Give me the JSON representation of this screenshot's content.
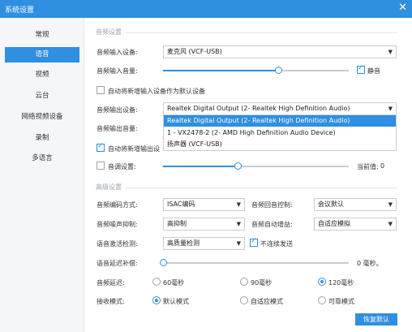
{
  "window": {
    "title": "系统设置"
  },
  "sidebar": {
    "items": [
      {
        "label": "常规"
      },
      {
        "label": "语音"
      },
      {
        "label": "视频"
      },
      {
        "label": "云台"
      },
      {
        "label": "网络视频设备"
      },
      {
        "label": "录制"
      },
      {
        "label": "多语言"
      }
    ],
    "active_index": 1
  },
  "audio_settings": {
    "section_title": "音频设置",
    "input_device": {
      "label": "音频输入设备:",
      "value": "麦克风 (VCF-USB)"
    },
    "input_volume": {
      "label": "音频输入音量:",
      "level_percent": 62,
      "mute_label": "静音",
      "mute_checked": true
    },
    "auto_default_input": {
      "label": "自动将新增输入设备作为默认设备",
      "checked": false
    },
    "output_device": {
      "label": "音频输出设备:",
      "value": "Realtek Digital Output (2- Realtek High Definition Audio)",
      "options": [
        "Realtek Digital Output (2- Realtek High Definition Audio)",
        "1 - VX2478-2 (2- AMD High Definition Audio Device)",
        "扬声器 (VCF-USB)"
      ],
      "highlighted_index": 0
    },
    "output_volume": {
      "label": "音频输出音量:"
    },
    "auto_default_output": {
      "label": "自动将新增输出设",
      "checked": true
    },
    "tone": {
      "label": "音调设置:",
      "checked": false,
      "level_percent": 40,
      "current_label": "当前值:",
      "current_value": "0"
    }
  },
  "advanced_settings": {
    "section_title": "高级设置",
    "codec": {
      "label": "音频编码方式:",
      "value": "ISAC编码"
    },
    "echo": {
      "label": "音频回音控制:",
      "value": "会议默认"
    },
    "noise": {
      "label": "音频噪声抑制:",
      "value": "高抑制"
    },
    "agc": {
      "label": "音频自动增益:",
      "value": "自适应模拟"
    },
    "vad": {
      "label": "语音激活检测:",
      "value": "高质量检测"
    },
    "no_continuous": {
      "label": "不连续发送",
      "checked": true
    },
    "delay_comp": {
      "label": "语音延迟补偿:",
      "level_percent": 0,
      "value_text": "0 毫秒。"
    },
    "audio_delay": {
      "label": "音频延迟:",
      "options": [
        "60毫秒",
        "90毫秒",
        "120毫秒"
      ],
      "selected_index": 2
    },
    "receive_mode": {
      "label": "接收模式:",
      "options": [
        "默认模式",
        "自适应模式",
        "可靠模式"
      ],
      "selected_index": 0
    },
    "restore_button": "恢复默认"
  },
  "icons": {
    "close": "close-icon",
    "dropdown": "chevron-down-icon"
  },
  "colors": {
    "accent": "#2f8fe0",
    "sidebar_bg": "#f4f6f9"
  }
}
